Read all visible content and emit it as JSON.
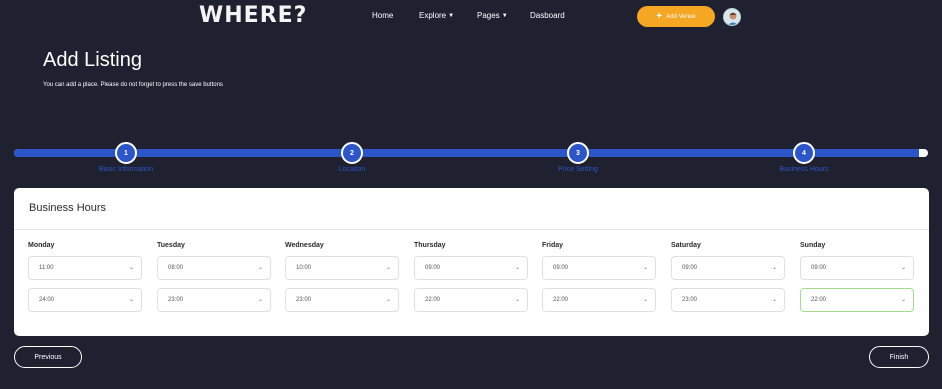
{
  "header": {
    "logo": "WHERE?",
    "nav": [
      {
        "label": "Home",
        "has_dropdown": false
      },
      {
        "label": "Explore",
        "has_dropdown": true
      },
      {
        "label": "Pages",
        "has_dropdown": true
      },
      {
        "label": "Dasboard",
        "has_dropdown": false
      }
    ],
    "add_venue_label": "Add Venue",
    "add_venue_color": "#f5a623"
  },
  "page": {
    "title": "Add Listing",
    "subtitle": "You can add a place. Please do not forget to press the save buttons"
  },
  "progress": {
    "value_percent": 99,
    "accent_color": "#2b55c9",
    "steps": [
      {
        "number": "1",
        "label": "Basic Information"
      },
      {
        "number": "2",
        "label": "Location"
      },
      {
        "number": "3",
        "label": "Price Setting"
      },
      {
        "number": "4",
        "label": "Business Hours"
      }
    ]
  },
  "business_hours": {
    "title": "Business Hours",
    "days": [
      {
        "day": "Monday",
        "open": "11:00",
        "close": "24:00"
      },
      {
        "day": "Tuesday",
        "open": "08:00",
        "close": "23:00"
      },
      {
        "day": "Wednesday",
        "open": "10:00",
        "close": "23:00"
      },
      {
        "day": "Thursday",
        "open": "09:00",
        "close": "22:00"
      },
      {
        "day": "Friday",
        "open": "09:00",
        "close": "22:00"
      },
      {
        "day": "Saturday",
        "open": "09:00",
        "close": "23:00"
      },
      {
        "day": "Sunday",
        "open": "09:00",
        "close": "22:00"
      }
    ],
    "focused_field_color": "#a6dc8c"
  },
  "footer": {
    "previous_label": "Previous",
    "finish_label": "Finish"
  },
  "icons": {
    "plus": "plus-icon",
    "dropdown": "chevron-down-icon",
    "avatar": "user-avatar"
  }
}
